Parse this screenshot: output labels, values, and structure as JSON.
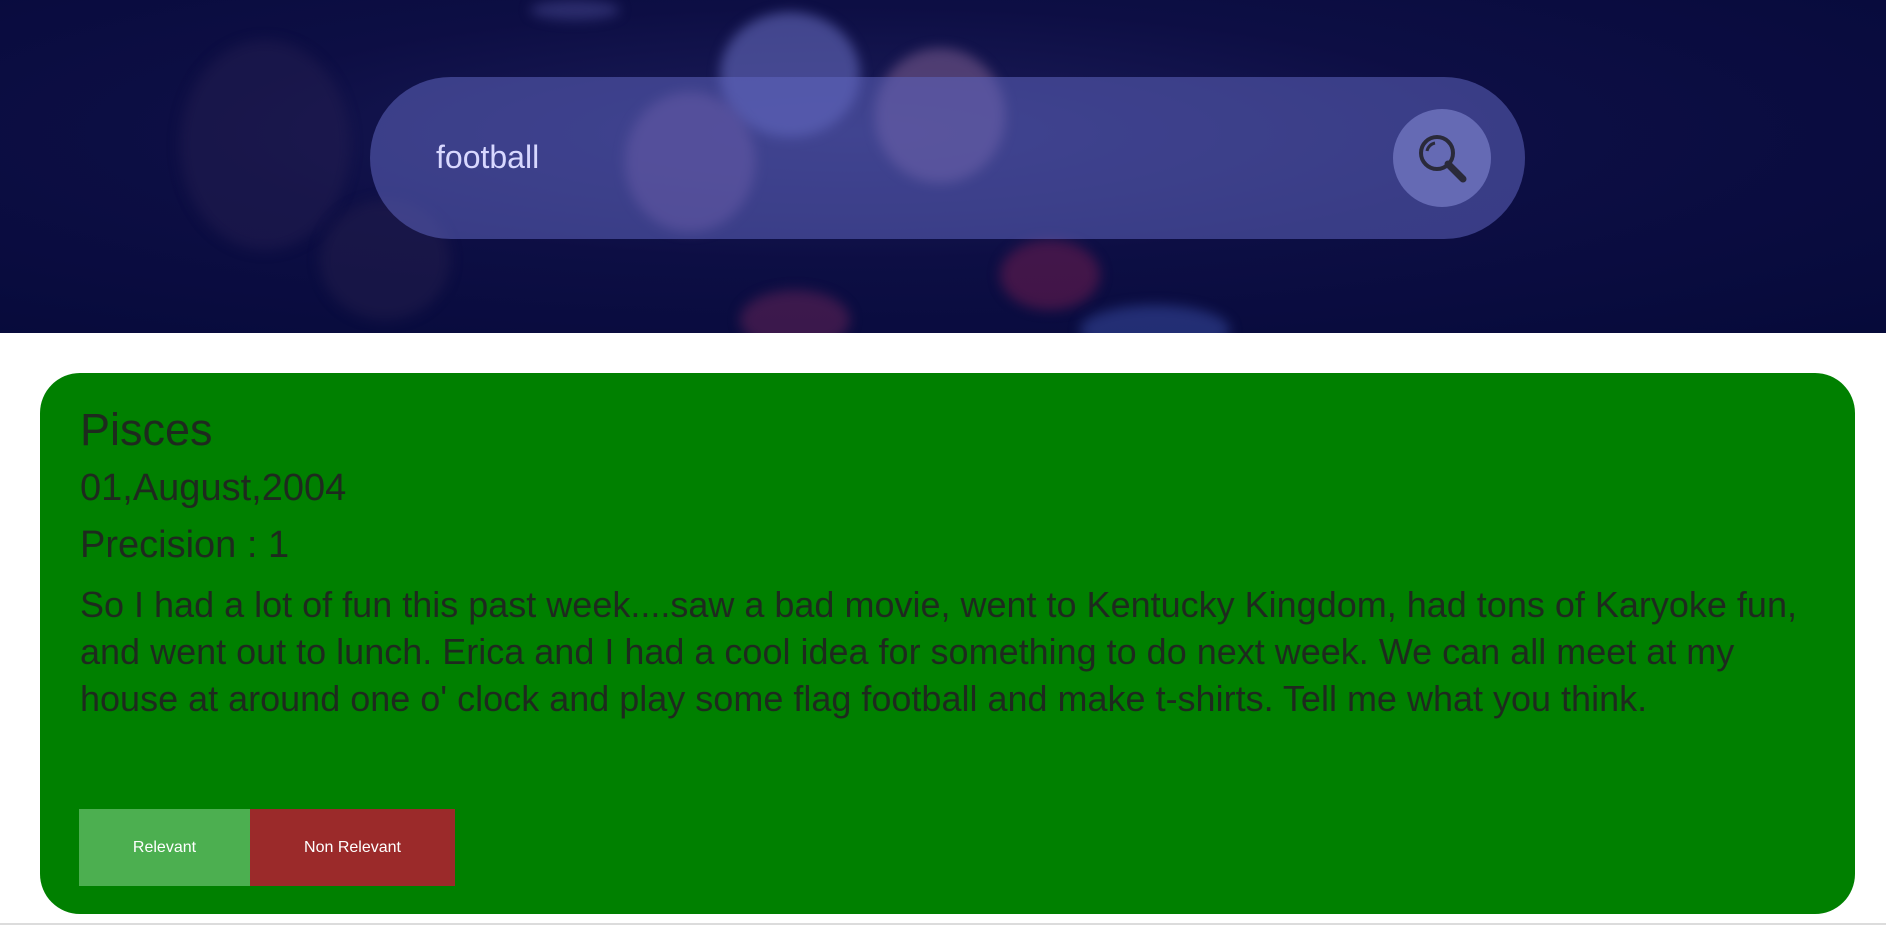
{
  "search": {
    "value": "football",
    "button_icon": "search-icon"
  },
  "result": {
    "title": "Pisces",
    "date": "01,August,2004",
    "precision": "Precision : 1",
    "text": "So I had a lot of fun this past week....saw a bad movie, went to Kentucky Kingdom, had tons of Karyoke fun, and went out to lunch. Erica and I had a cool idea for something to do next week. We can all meet at my house at around one o' clock and play some flag football and make t-shirts. Tell me what you think.",
    "buttons": {
      "relevant": "Relevant",
      "non_relevant": "Non Relevant"
    }
  },
  "colors": {
    "card_background": "#008000",
    "relevant_button": "#4caf50",
    "non_relevant_button": "#9b2a2a",
    "hero_background": "#060a3a"
  }
}
